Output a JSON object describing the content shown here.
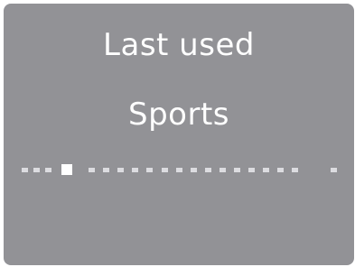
{
  "screen": {
    "title": "Last used",
    "subtitle": "Sports"
  },
  "page_indicator": {
    "total_pages": 20,
    "current_page": 4,
    "colors": {
      "active": "#ffffff",
      "inactive": "#dcdce0",
      "background": "#929296"
    }
  }
}
